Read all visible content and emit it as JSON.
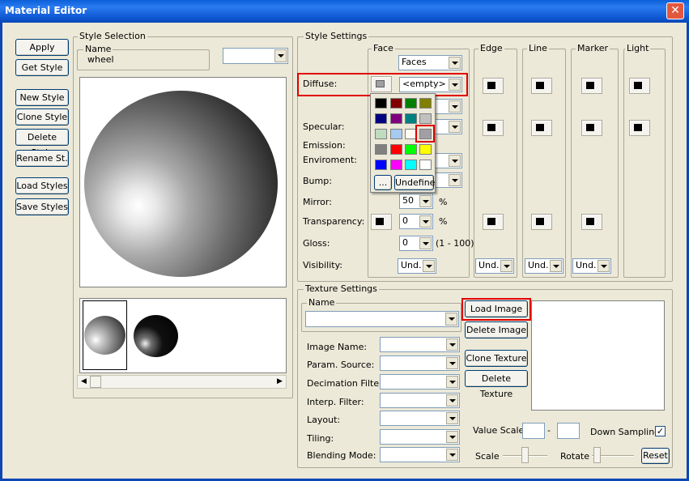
{
  "window": {
    "title": "Material Editor"
  },
  "left_buttons": [
    "Apply",
    "Get Style",
    "New Style",
    "Clone Style",
    "Delete Style",
    "Rename St.",
    "Load Styles",
    "Save Styles"
  ],
  "style_selection": {
    "group": "Style Selection",
    "name_label": "Name",
    "name_value": "wheel"
  },
  "style_settings": {
    "group": "Style Settings",
    "col_face": "Face",
    "col_edge": "Edge",
    "col_line": "Line",
    "col_marker": "Marker",
    "col_light": "Light",
    "faces_combo": "Faces",
    "diffuse": "Diffuse:",
    "diffuse_combo": "<empty>",
    "specular": "Specular:",
    "emission": "Emission:",
    "enviroment": "Enviroment:",
    "bump": "Bump:",
    "mirror": "Mirror:",
    "mirror_value": "50",
    "transparency": "Transparency:",
    "transparency_value": "0",
    "gloss": "Gloss:",
    "gloss_value": "0",
    "gloss_range": "(1 - 100)",
    "visibility": "Visibility:",
    "percent": "%",
    "und": "Und."
  },
  "palette": {
    "colors": [
      "#000000",
      "#800000",
      "#008000",
      "#808000",
      "#000080",
      "#800080",
      "#008080",
      "#c0c0c0",
      "#c0dcc0",
      "#a6caf0",
      "#fffbf0",
      "#a0a0a4",
      "#808080",
      "#ff0000",
      "#00ff00",
      "#ffff00",
      "#0000ff",
      "#ff00ff",
      "#00ffff",
      "#ffffff"
    ],
    "more": "...",
    "undefine": "Undefine",
    "selected_color": "#a0a0a4"
  },
  "texture": {
    "group": "Texture Settings",
    "name_label": "Name",
    "load": "Load Image",
    "delete_image": "Delete Image",
    "clone": "Clone Texture",
    "delete_texture": "Delete Texture",
    "fields": [
      "Image Name:",
      "Param. Source:",
      "Decimation Filter:",
      "Interp. Filter:",
      "Layout:",
      "Tiling:",
      "Blending Mode:"
    ],
    "value_scale": "Value Scale:",
    "dash": "-",
    "down_sampling": "Down Sampling:",
    "scale": "Scale",
    "rotate": "Rotate",
    "reset": "Reset"
  }
}
